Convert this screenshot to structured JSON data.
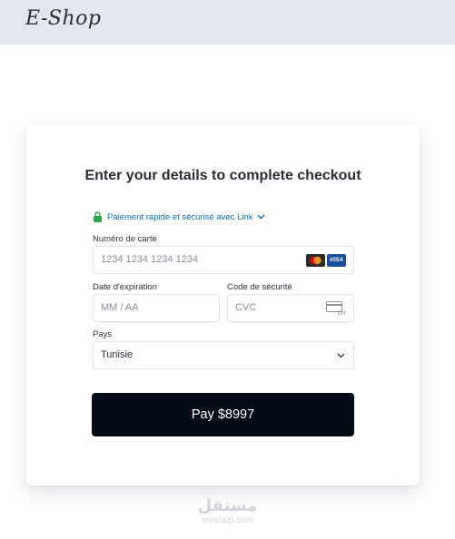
{
  "header": {
    "brand": "E-Shop"
  },
  "checkout": {
    "title": "Enter your details to complete checkout",
    "link_text": "Paiement rapide et sécurisé avec Link",
    "card_number": {
      "label": "Numéro de carte",
      "placeholder": "1234 1234 1234 1234",
      "brands": [
        "mastercard",
        "VISA"
      ]
    },
    "expiry": {
      "label": "Date d'expiration",
      "placeholder": "MM / AA"
    },
    "cvc": {
      "label": "Code de sécurité",
      "placeholder": "CVC",
      "icon_text": "123"
    },
    "country": {
      "label": "Pays",
      "value": "Tunisie"
    },
    "pay_button": "Pay $8997"
  },
  "watermark": {
    "arabic": "مستقل",
    "latin": "mostaql.com"
  },
  "colors": {
    "accent_link": "#0a6fc2",
    "lock_green": "#2aa84a",
    "button_bg": "#050b17",
    "header_bg": "#e3e8ef"
  }
}
